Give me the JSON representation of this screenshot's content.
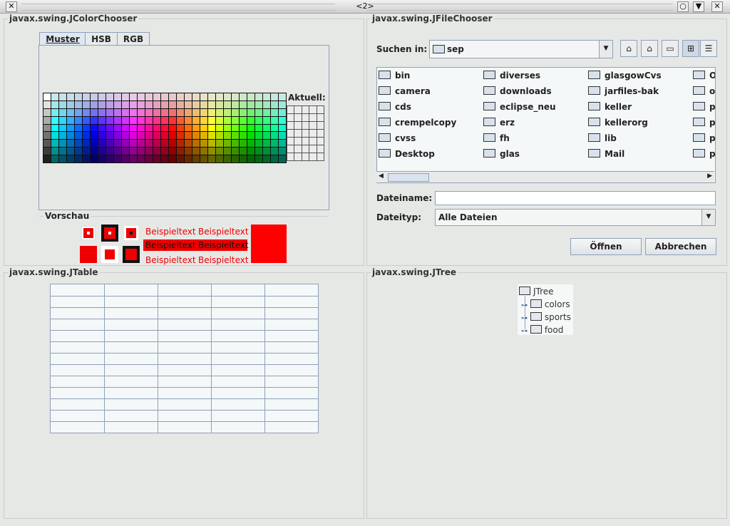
{
  "window": {
    "title": "<2>",
    "close_glyph": "✕",
    "buttons": [
      "○",
      "▼",
      "✕"
    ]
  },
  "color_chooser": {
    "title": "javax.swing.JColorChooser",
    "tabs": [
      "Muster",
      "HSB",
      "RGB"
    ],
    "recent_label": "Aktuell:",
    "preview_label": "Vorschau",
    "sample_text": "Beispieltext",
    "selected_color": "#ff0000"
  },
  "file_chooser": {
    "title": "javax.swing.JFileChooser",
    "look_in_label": "Suchen in:",
    "look_in_value": "sep",
    "files_col1": [
      "bin",
      "camera",
      "cds",
      "crempelcopy",
      "cvss",
      "Desktop"
    ],
    "files_col2": [
      "diverses",
      "downloads",
      "eclipse_neu",
      "erz",
      "fh",
      "glas"
    ],
    "files_col3": [
      "glasgowCvs",
      "jarfiles-bak",
      "keller",
      "kellerorg",
      "lib",
      "Mail"
    ],
    "files_col4": [
      "Oi",
      "oi",
      "pa",
      "pa",
      "pl",
      "pl"
    ],
    "filename_label": "Dateiname:",
    "filename_value": "",
    "filetype_label": "Dateityp:",
    "filetype_value": "Alle Dateien",
    "open_button": "Öffnen",
    "cancel_button": "Abbrechen"
  },
  "table": {
    "title": "javax.swing.JTable"
  },
  "tree": {
    "title": "javax.swing.JTree",
    "root": "JTree",
    "children": [
      "colors",
      "sports",
      "food"
    ]
  }
}
